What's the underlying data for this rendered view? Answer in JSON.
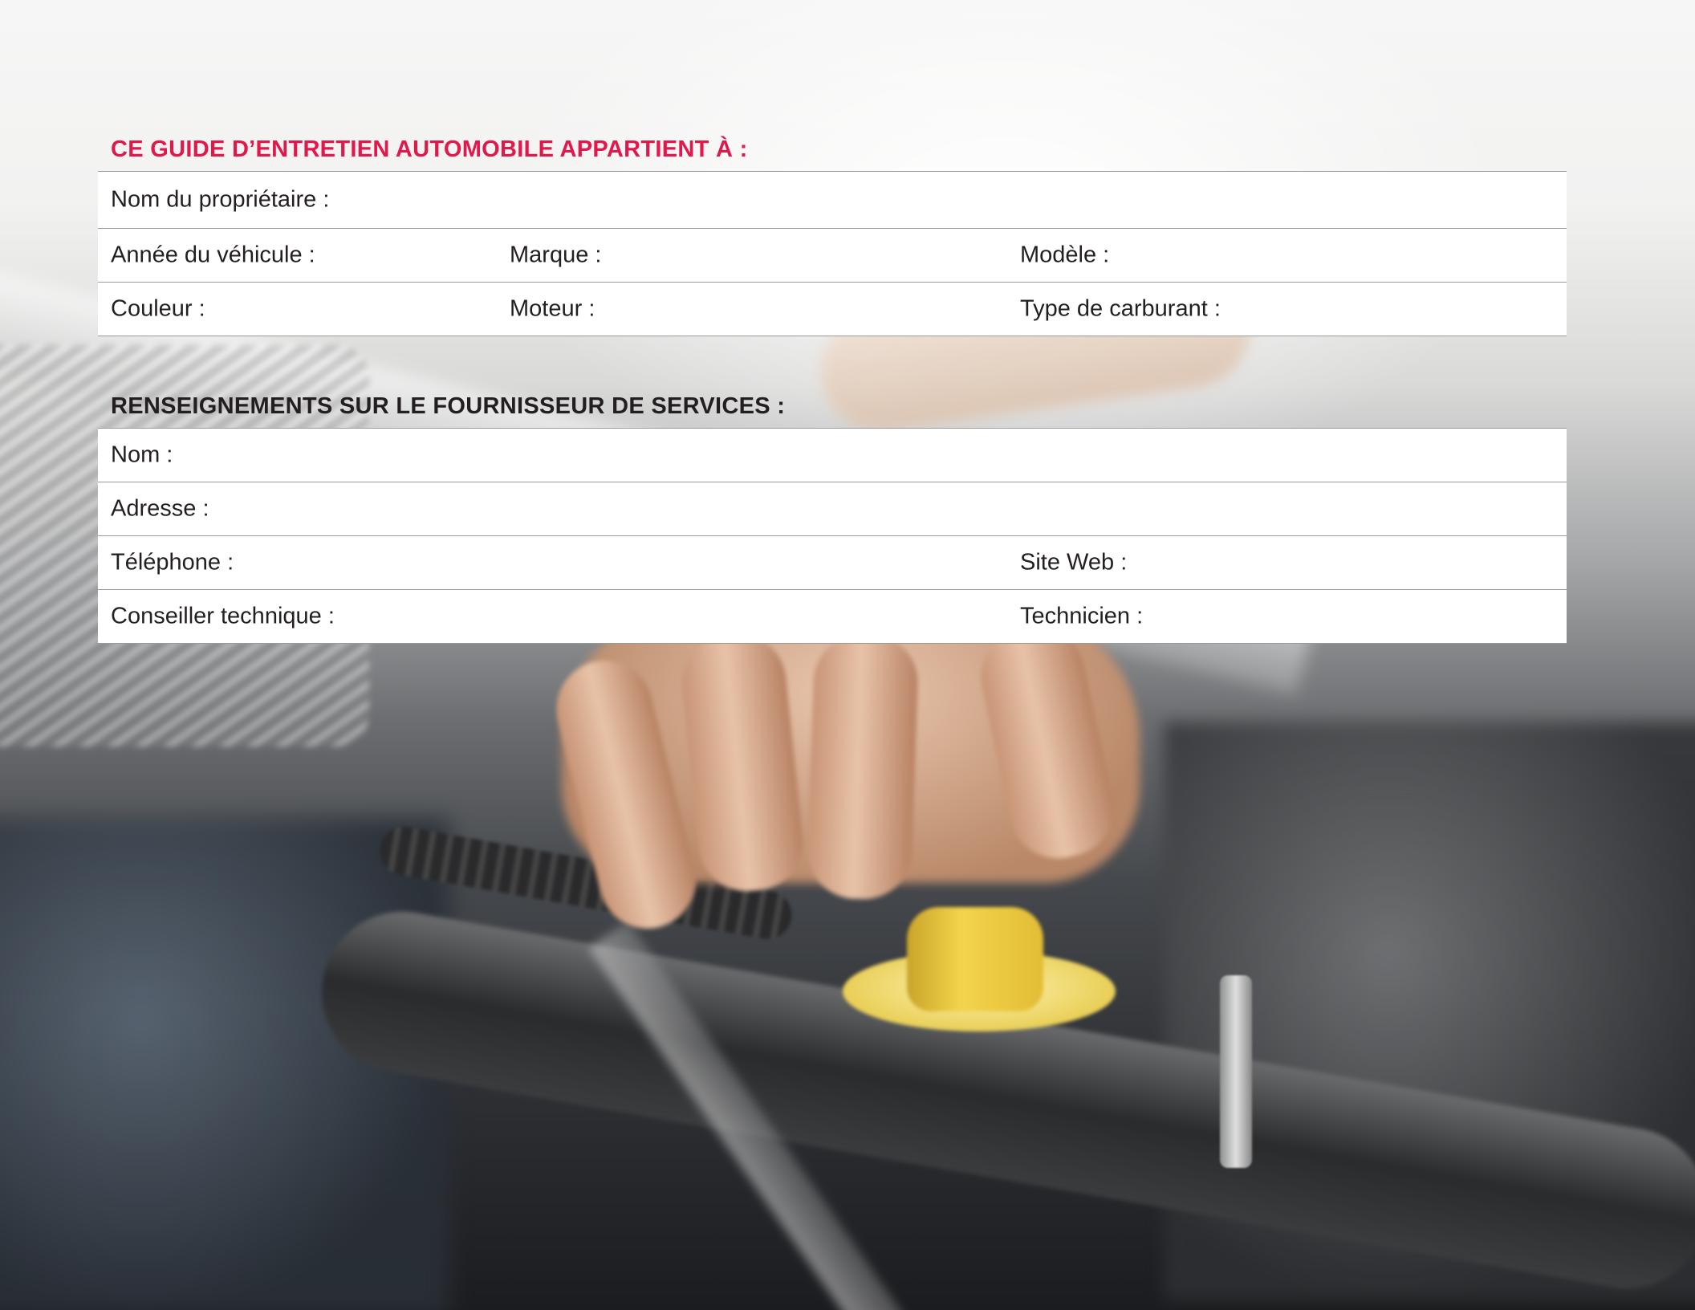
{
  "owner_section": {
    "title": "CE GUIDE D’ENTRETIEN AUTOMOBILE APPARTIENT À :",
    "owner_name_label": "Nom du propriétaire :",
    "vehicle_year_label": "Année du véhicule :",
    "make_label": "Marque :",
    "model_label": "Modèle :",
    "color_label": "Couleur :",
    "engine_label": "Moteur :",
    "fuel_type_label": "Type de carburant :"
  },
  "provider_section": {
    "title": "RENSEIGNEMENTS SUR LE FOURNISSEUR DE SERVICES :",
    "name_label": "Nom :",
    "address_label": "Adresse :",
    "phone_label": "Téléphone :",
    "website_label": "Site Web :",
    "advisor_label": "Conseiller technique :",
    "technician_label": "Technicien :"
  },
  "colors": {
    "accent_title": "#e0184b",
    "text": "#231f20",
    "rule": "#9a9a9a"
  }
}
